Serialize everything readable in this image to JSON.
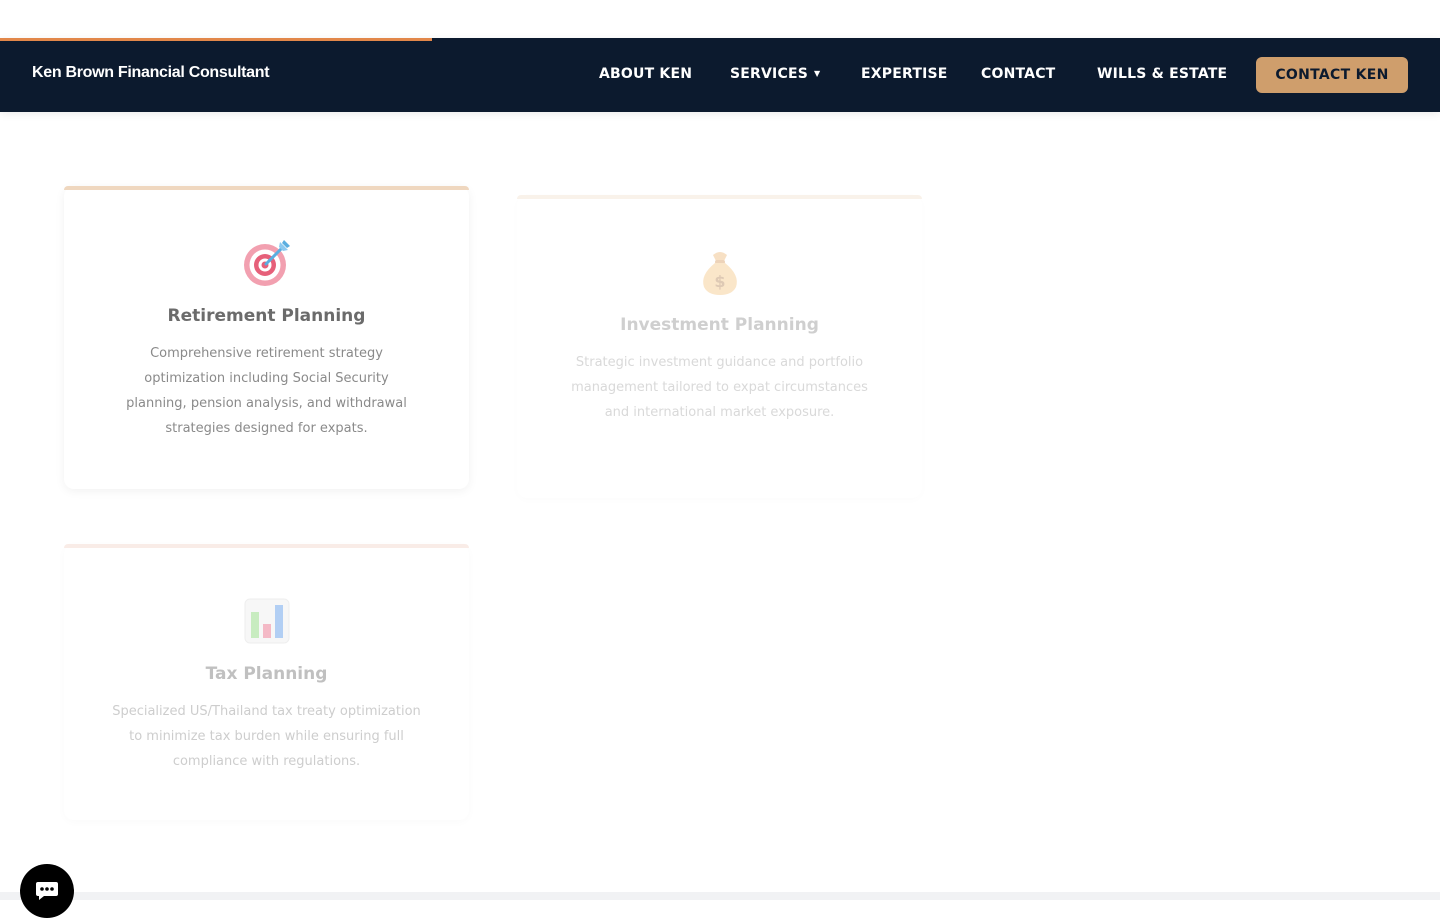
{
  "page": {
    "progress": 0.3,
    "colors": {
      "nav_bg": "#0c1a2e",
      "accent": "#cf9e6c",
      "progress": "#e2874a"
    }
  },
  "header": {
    "brand": "Ken Brown Financial Consultant",
    "nav": [
      "ABOUT KEN",
      "SERVICES",
      "EXPERTISE",
      "CONTACT",
      "WILLS & ESTATE"
    ],
    "cta_label": "CONTACT KEN"
  },
  "services": [
    {
      "icon": "target-icon",
      "title": "Retirement Planning",
      "description": "Comprehensive retirement strategy optimization including Social Security planning, pension analysis, and withdrawal strategies designed for expats."
    },
    {
      "icon": "money-bag-icon",
      "title": "Investment Planning",
      "description": "Strategic investment guidance and portfolio management tailored to expat circumstances and international market exposure."
    },
    {
      "icon": "bar-chart-icon",
      "title": "Tax Planning",
      "description": "Specialized US/Thailand tax treaty optimization to minimize tax burden while ensuring full compliance with regulations."
    }
  ],
  "chat": {
    "icon": "chat-icon"
  }
}
